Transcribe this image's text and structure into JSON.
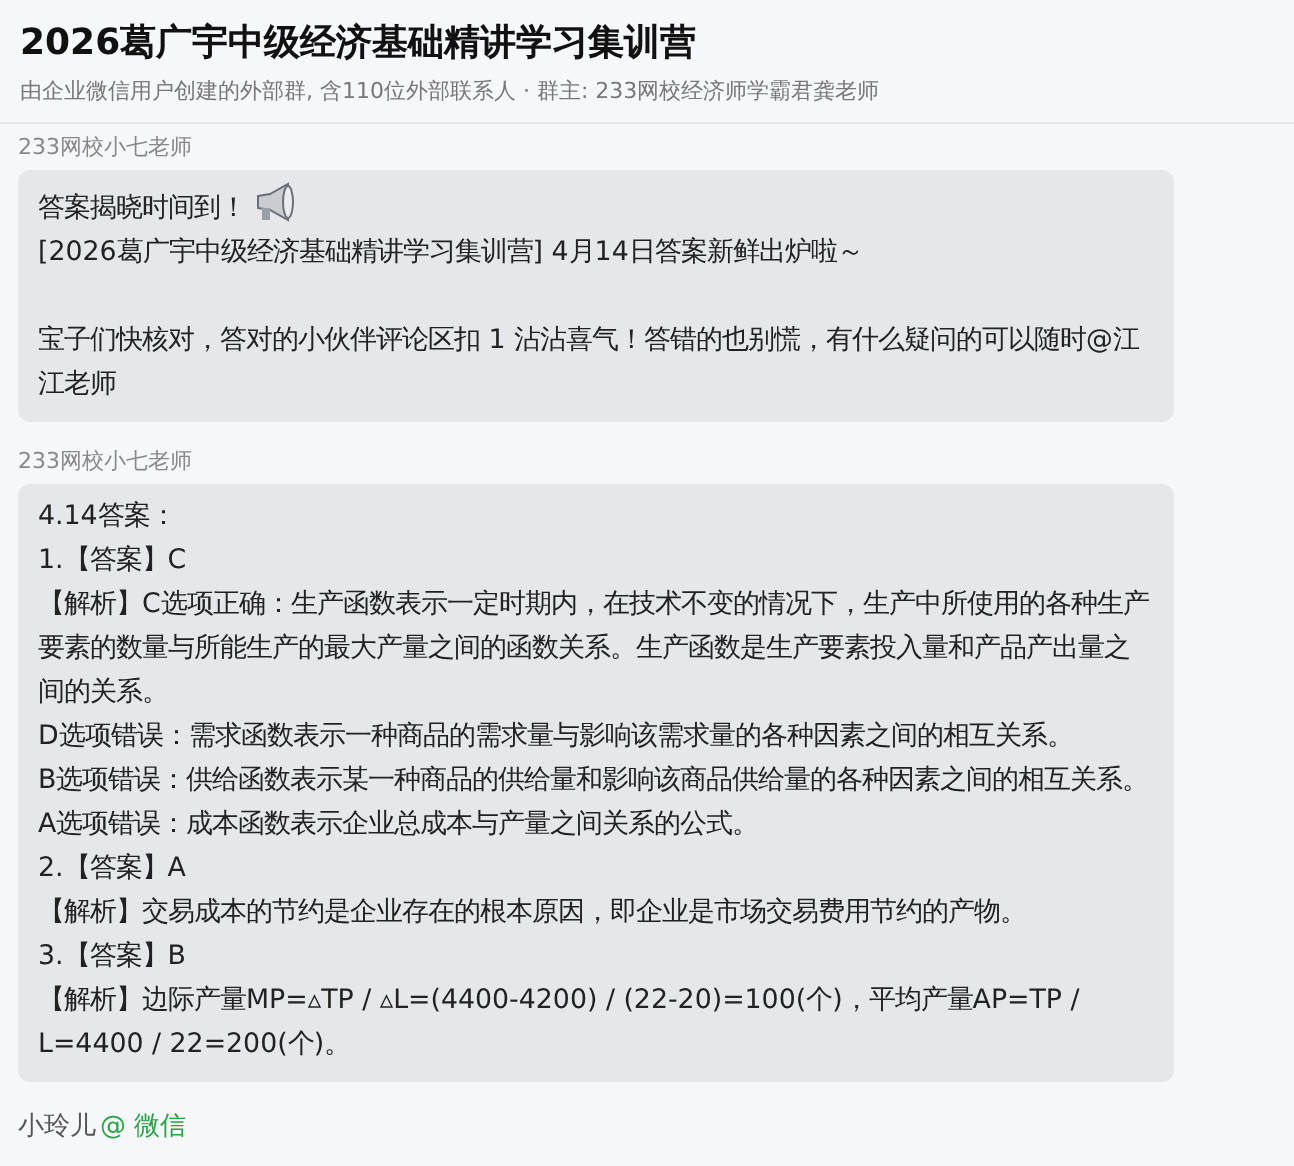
{
  "header": {
    "title": "2026葛广宇中级经济基础精讲学习集训营",
    "subtitle": "由企业微信用户创建的外部群, 含110位外部联系人 · 群主: 233网校经济师学霸君龚老师"
  },
  "messages": [
    {
      "sender": "233网校小七老师",
      "paragraphs": [
        {
          "kind": "with_icon",
          "text": "答案揭晓时间到！"
        },
        {
          "kind": "plain",
          "text": "[2026葛广宇中级经济基础精讲学习集训营] 4月14日答案新鲜出炉啦～"
        },
        {
          "kind": "spaced",
          "text": "宝子们快核对，答对的小伙伴评论区扣 1 沾沾喜气！答错的也别慌，有什么疑问的可以随时@江江老师"
        }
      ]
    },
    {
      "sender": "233网校小七老师",
      "paragraphs": [
        {
          "kind": "plain",
          "text": "4.14答案："
        },
        {
          "kind": "plain",
          "text": "1.【答案】C"
        },
        {
          "kind": "plain",
          "text": "【解析】C选项正确：生产函数表示一定时期内，在技术不变的情况下，生产中所使用的各种生产要素的数量与所能生产的最大产量之间的函数关系。生产函数是生产要素投入量和产品产出量之间的关系。"
        },
        {
          "kind": "plain",
          "text": "D选项错误：需求函数表示一种商品的需求量与影响该需求量的各种因素之间的相互关系。"
        },
        {
          "kind": "plain",
          "text": "B选项错误：供给函数表示某一种商品的供给量和影响该商品供给量的各种因素之间的相互关系。"
        },
        {
          "kind": "plain",
          "text": "A选项错误：成本函数表示企业总成本与产量之间关系的公式。"
        },
        {
          "kind": "plain",
          "text": "2.【答案】A"
        },
        {
          "kind": "plain",
          "text": "【解析】交易成本的节约是企业存在的根本原因，即企业是市场交易费用节约的产物。"
        },
        {
          "kind": "plain",
          "text": "3.【答案】B"
        },
        {
          "kind": "plain",
          "text": "【解析】边际产量MP=▵TP / ▵L=(4400-4200) / (22-20)=100(个)，平均产量AP=TP / L=4400 / 22=200(个)。"
        }
      ]
    }
  ],
  "next_sender": {
    "name": "小玲儿",
    "source": "@ 微信"
  }
}
